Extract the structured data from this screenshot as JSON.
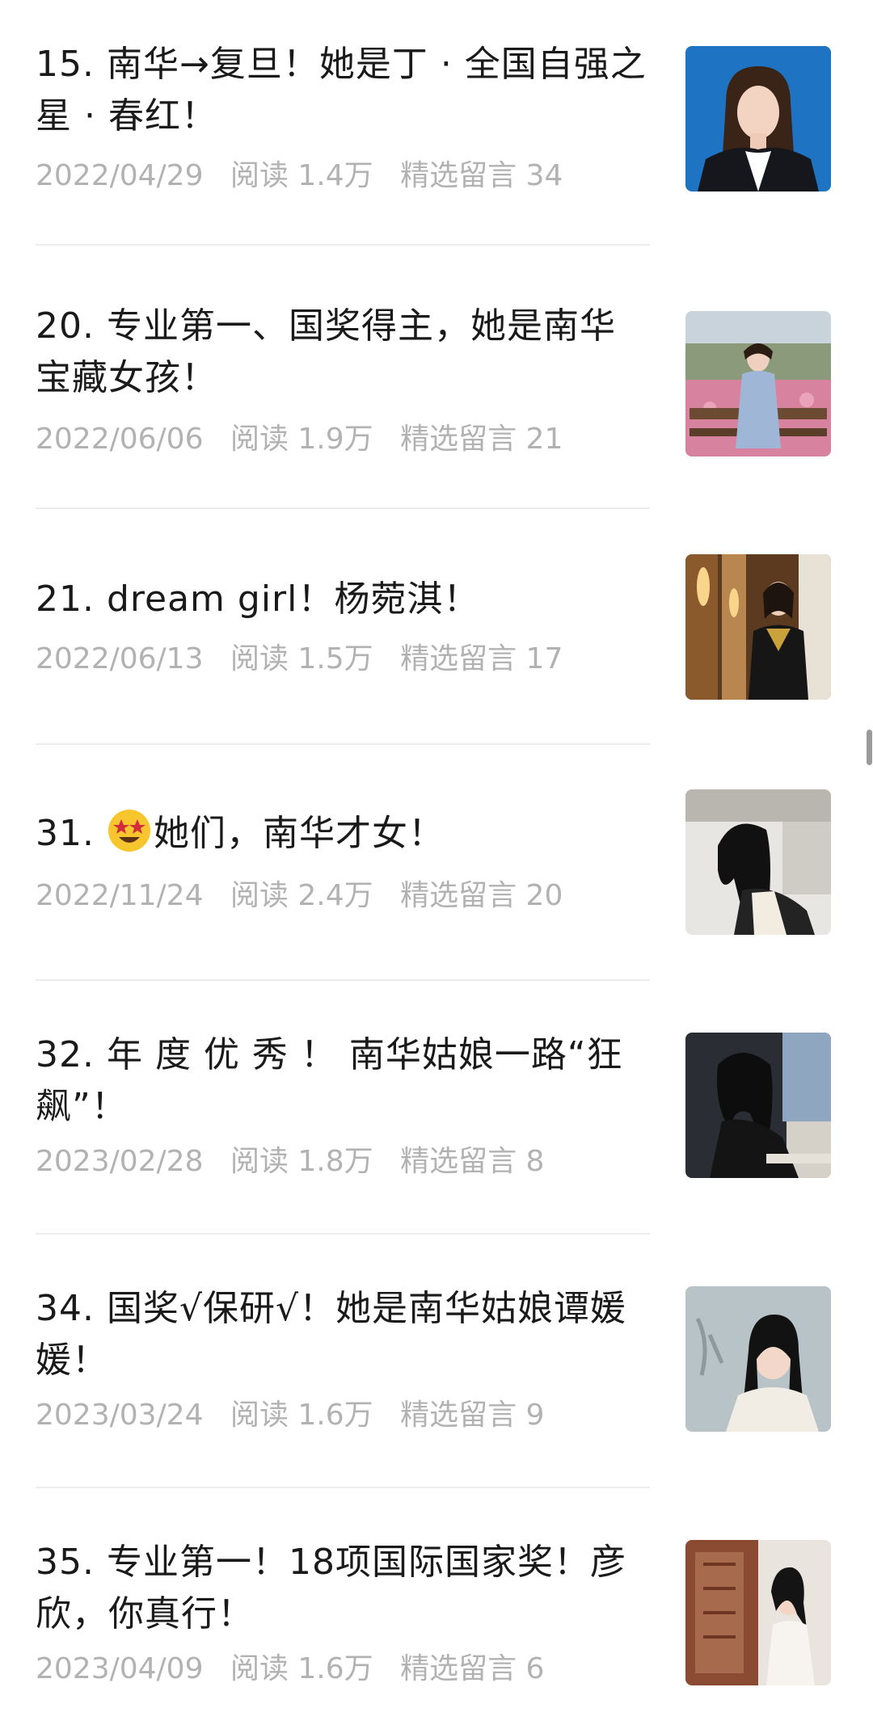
{
  "articles": [
    {
      "title_prefix": "",
      "title": "15. 南华→复旦！她是丁 · 全国自强之星 · 春红！",
      "date": "2022/04/29",
      "reads": "阅读 1.4万",
      "comments": "精选留言 34"
    },
    {
      "title_prefix": "",
      "title": "20. 专业第一、国奖得主，她是南华宝藏女孩！",
      "date": "2022/06/06",
      "reads": "阅读 1.9万",
      "comments": "精选留言 21"
    },
    {
      "title_prefix": "",
      "title": "21. dream girl！杨菀淇！",
      "date": "2022/06/13",
      "reads": "阅读 1.5万",
      "comments": "精选留言 17"
    },
    {
      "title_prefix": "31. ",
      "title": "她们，南华才女！",
      "date": "2022/11/24",
      "reads": "阅读 2.4万",
      "comments": "精选留言 20"
    },
    {
      "title_prefix": "",
      "title": "32. 年 度 优 秀 ！ 南华姑娘一路“狂飙”！",
      "date": "2023/02/28",
      "reads": "阅读 1.8万",
      "comments": "精选留言 8"
    },
    {
      "title_prefix": "",
      "title": "34. 国奖√保研√！她是南华姑娘谭媛媛！",
      "date": "2023/03/24",
      "reads": "阅读 1.6万",
      "comments": "精选留言 9"
    },
    {
      "title_prefix": "",
      "title": "35. 专业第一！18项国际国家奖！彦欣，你真行！",
      "date": "2023/04/09",
      "reads": "阅读 1.6万",
      "comments": "精选留言 6"
    }
  ],
  "icons": {
    "star_struck_emoji": "star-struck-emoji-icon"
  },
  "colors": {
    "title": "#1a1a1a",
    "meta": "#b2b2b2",
    "divider": "#ededed",
    "scrollbar": "#9a9a9a"
  }
}
